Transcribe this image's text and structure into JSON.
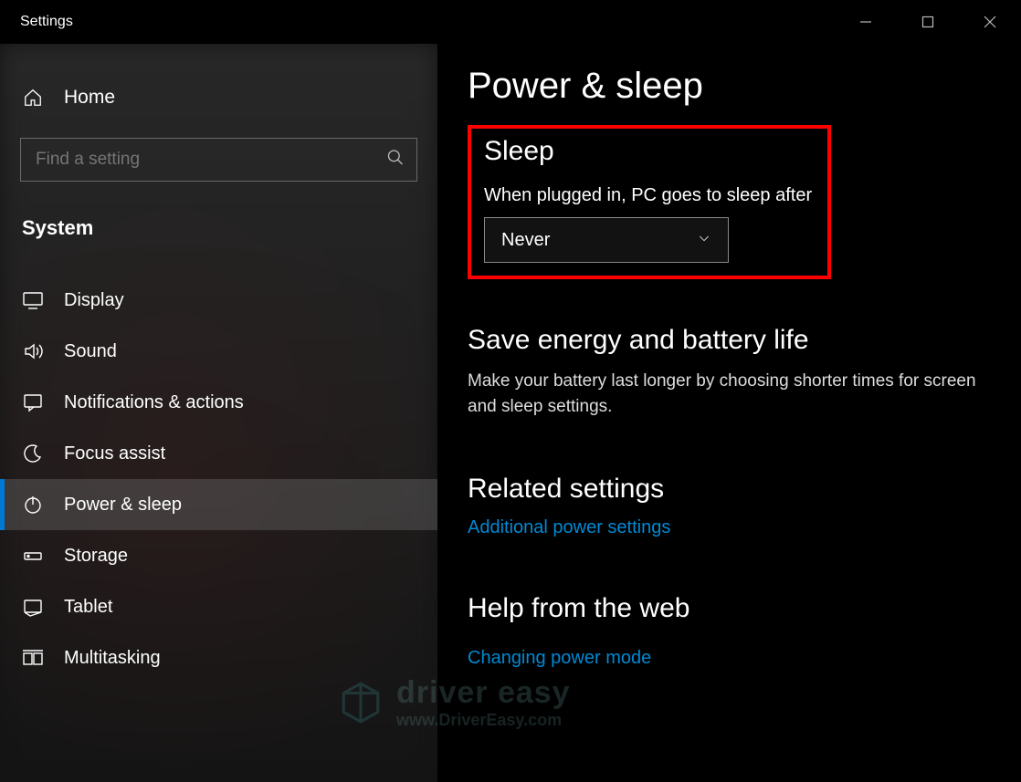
{
  "window": {
    "title": "Settings"
  },
  "sidebar": {
    "home_label": "Home",
    "search_placeholder": "Find a setting",
    "category": "System",
    "items": [
      {
        "label": "Display",
        "selected": false
      },
      {
        "label": "Sound",
        "selected": false
      },
      {
        "label": "Notifications & actions",
        "selected": false
      },
      {
        "label": "Focus assist",
        "selected": false
      },
      {
        "label": "Power & sleep",
        "selected": true
      },
      {
        "label": "Storage",
        "selected": false
      },
      {
        "label": "Tablet",
        "selected": false
      },
      {
        "label": "Multitasking",
        "selected": false
      }
    ]
  },
  "main": {
    "title": "Power & sleep",
    "sleep": {
      "heading": "Sleep",
      "label": "When plugged in, PC goes to sleep after",
      "value": "Never"
    },
    "energy": {
      "heading": "Save energy and battery life",
      "desc": "Make your battery last longer by choosing shorter times for screen and sleep settings."
    },
    "related": {
      "heading": "Related settings",
      "link": "Additional power settings"
    },
    "help": {
      "heading": "Help from the web",
      "link": "Changing power mode"
    }
  },
  "watermark": {
    "line1": "driver easy",
    "line2": "www.DriverEasy.com"
  }
}
